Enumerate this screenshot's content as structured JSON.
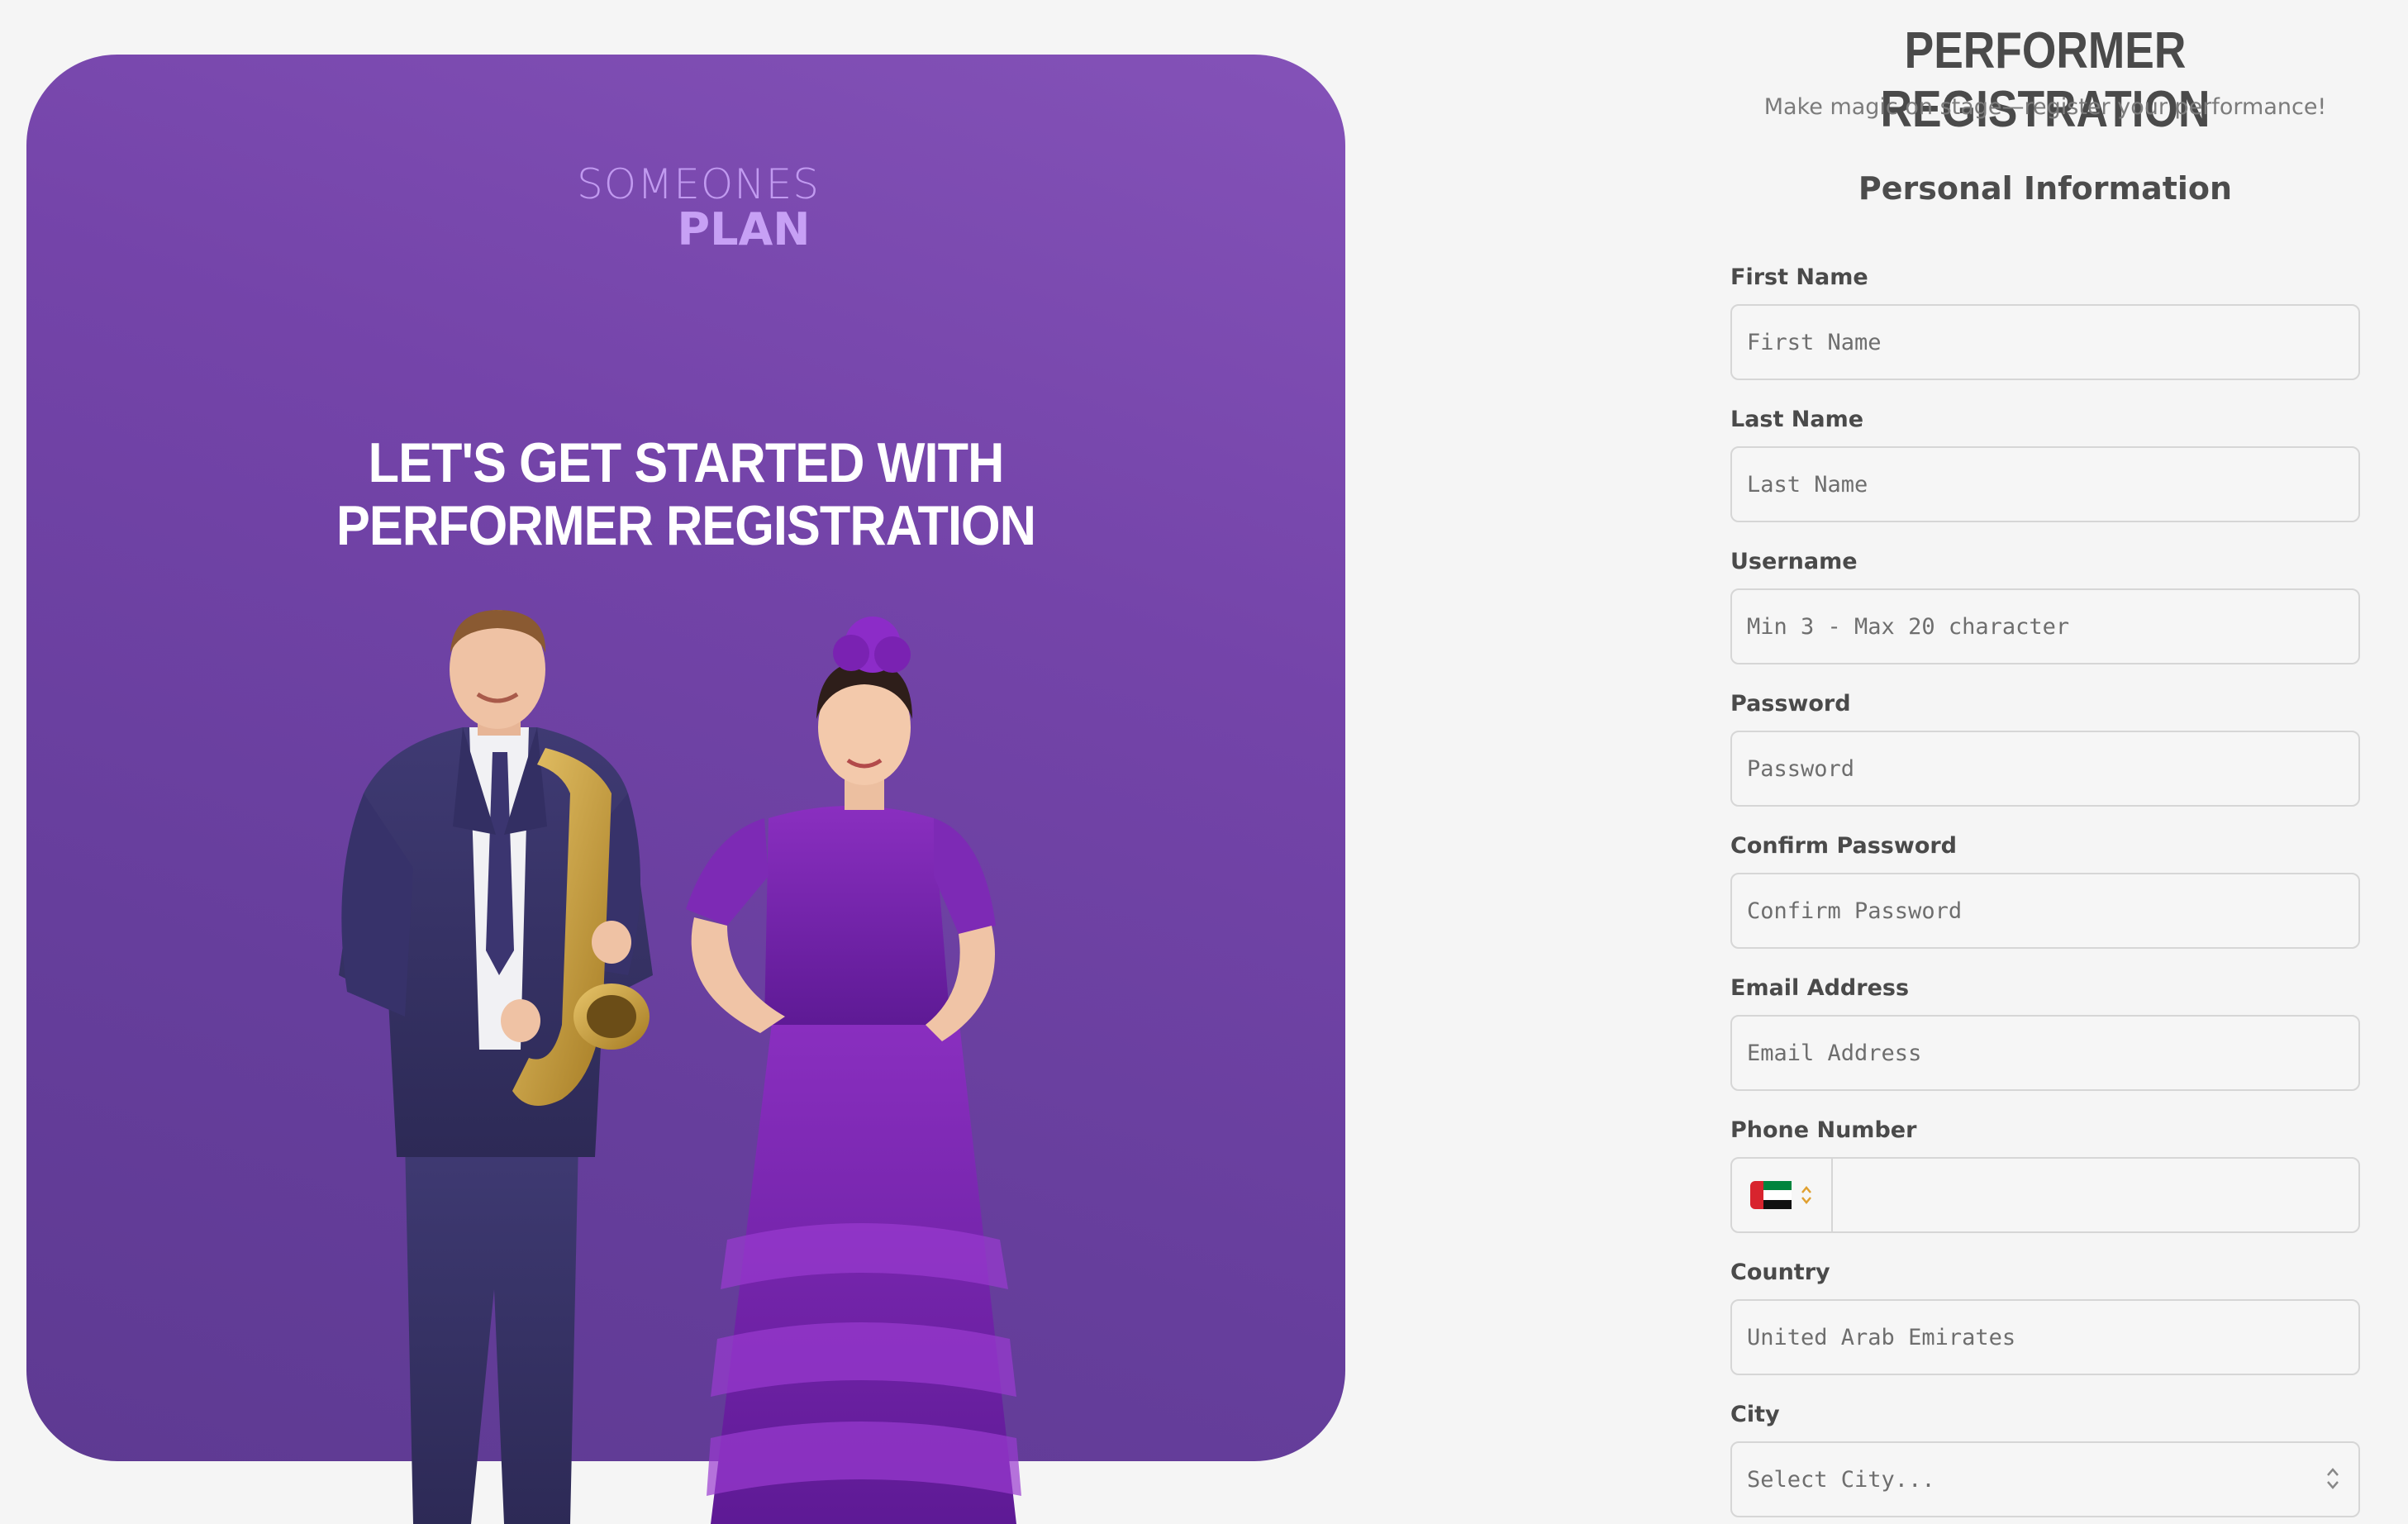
{
  "brand": {
    "logo_top": "SOMEONES",
    "logo_bottom": "PLAN",
    "logo_color": "#c7a0f5",
    "accent_purple": "#7444a9"
  },
  "hero": {
    "title": "LET'S GET STARTED WITH PERFORMER REGISTRATION",
    "illustration": "saxophonist-and-flamenco-dancer"
  },
  "form": {
    "title": "PERFORMER REGISTRATION",
    "subtitle": "Make magic on stage—register your performance!",
    "section_title": "Personal Information",
    "fields": {
      "first_name": {
        "label": "First Name",
        "placeholder": "First Name"
      },
      "last_name": {
        "label": "Last Name",
        "placeholder": "Last Name"
      },
      "username": {
        "label": "Username",
        "placeholder": "Min 3 - Max 20 character"
      },
      "password": {
        "label": "Password",
        "placeholder": "Password"
      },
      "confirm_password": {
        "label": "Confirm Password",
        "placeholder": "Confirm Password"
      },
      "email": {
        "label": "Email Address",
        "placeholder": "Email Address"
      },
      "phone": {
        "label": "Phone Number",
        "value": "",
        "country_flag": "uae-flag-icon"
      },
      "country": {
        "label": "Country",
        "placeholder": "United Arab Emirates"
      },
      "city": {
        "label": "City",
        "placeholder": "Select City..."
      }
    }
  }
}
